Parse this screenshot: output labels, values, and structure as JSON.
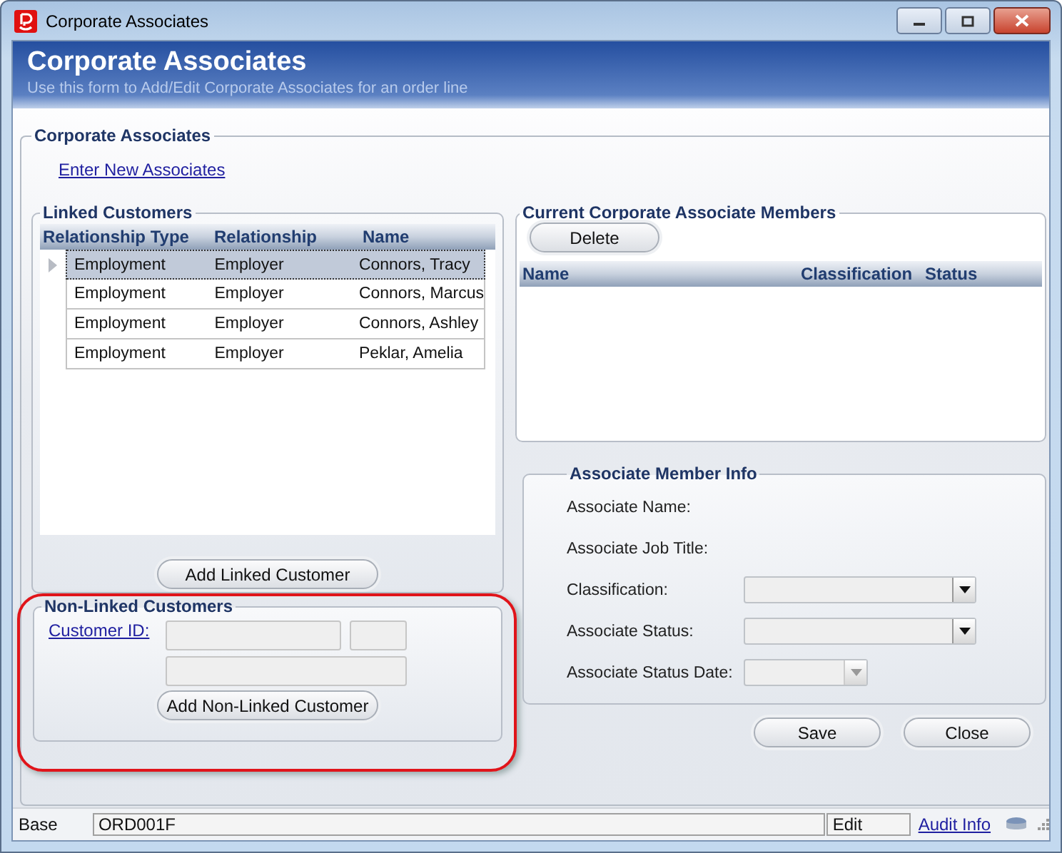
{
  "window": {
    "title": "Corporate Associates"
  },
  "header": {
    "title": "Corporate Associates",
    "subtitle": "Use this form to Add/Edit Corporate Associates for an order line"
  },
  "main_group": {
    "title": "Corporate Associates",
    "link": "Enter New Associates"
  },
  "linked_customers": {
    "title": "Linked Customers",
    "columns": [
      "Relationship Type",
      "Relationship",
      "Name"
    ],
    "rows": [
      {
        "cells": [
          "Employment",
          "Employer",
          "Connors, Tracy"
        ],
        "selected": true
      },
      {
        "cells": [
          "Employment",
          "Employer",
          "Connors, Marcus"
        ],
        "selected": false
      },
      {
        "cells": [
          "Employment",
          "Employer",
          "Connors, Ashley"
        ],
        "selected": false
      },
      {
        "cells": [
          "Employment",
          "Employer",
          "Peklar, Amelia"
        ],
        "selected": false
      }
    ],
    "button": "Add Linked Customer"
  },
  "non_linked_customers": {
    "title": "Non-Linked Customers",
    "highlighted": true,
    "customer_id_label": "Customer ID:",
    "button": "Add Non-Linked Customer"
  },
  "current_members": {
    "title": "Current Corporate Associate Members",
    "delete_button": "Delete",
    "columns": [
      "Name",
      "Classification",
      "Status"
    ]
  },
  "member_info": {
    "title": "Associate Member Info",
    "fields": [
      {
        "label": "Associate Name:",
        "kind": "text"
      },
      {
        "label": "Associate Job Title:",
        "kind": "text"
      },
      {
        "label": "Classification:",
        "kind": "dropdown"
      },
      {
        "label": "Associate Status:",
        "kind": "dropdown"
      },
      {
        "label": "Associate Status Date:",
        "kind": "date"
      }
    ]
  },
  "buttons": [
    "Save",
    "Close"
  ],
  "status_bar": {
    "section": "Base",
    "form_id": "ORD001F",
    "mode": "Edit",
    "link": "Audit Info"
  }
}
